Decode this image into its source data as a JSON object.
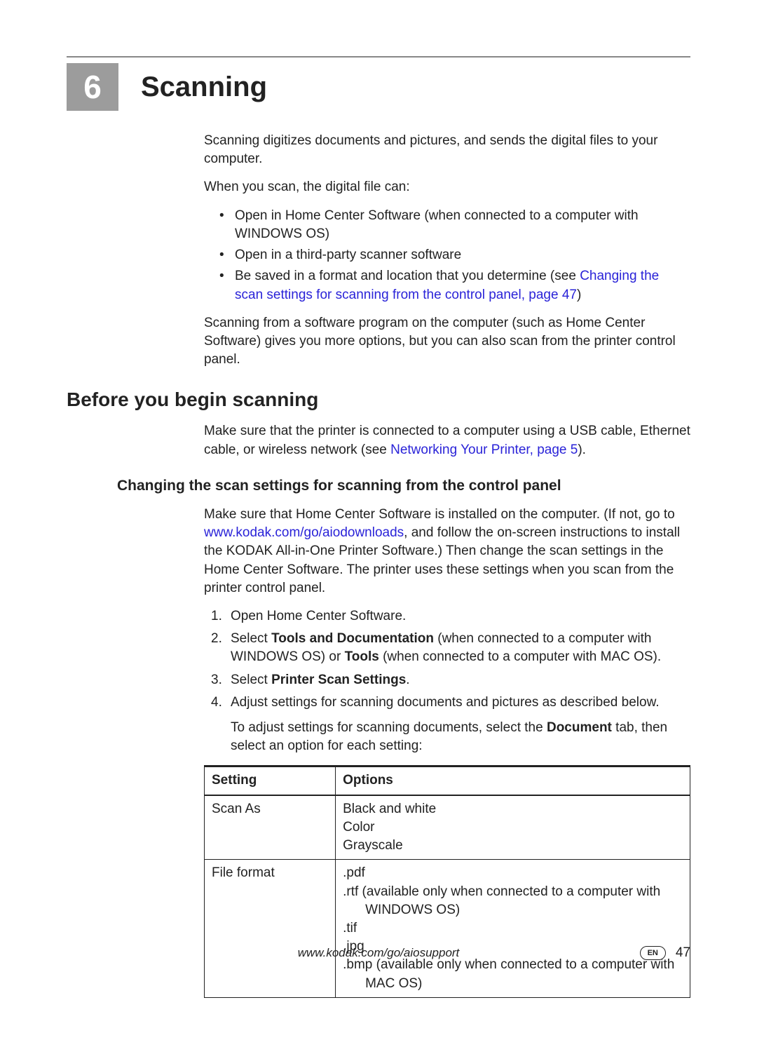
{
  "chapter": {
    "number": "6",
    "title": "Scanning"
  },
  "intro": {
    "p1": "Scanning digitizes documents and pictures, and sends the digital files to your computer.",
    "p2": "When you scan, the digital file can:",
    "bullets": {
      "b1": "Open in Home Center Software (when connected to a computer with WINDOWS OS)",
      "b2": "Open in a third-party scanner software",
      "b3_a": "Be saved in a format and location that you determine (see ",
      "b3_link": "Changing the scan settings for scanning from the control panel, page 47",
      "b3_b": ")"
    },
    "p3": "Scanning from a software program on the computer (such as Home Center Software) gives you more options, but you can also scan from the printer control panel."
  },
  "section2": {
    "heading": "Before you begin scanning",
    "p1_a": "Make sure that the printer is connected to a computer using a USB cable, Ethernet cable, or wireless network (see ",
    "p1_link": "Networking Your Printer, page 5",
    "p1_b": ")."
  },
  "section3": {
    "heading": "Changing the scan settings for scanning from the control panel",
    "p1_a": "Make sure that Home Center Software is installed on the computer. (If not, go to ",
    "p1_link": "www.kodak.com/go/aiodownloads",
    "p1_b": ", and follow the on-screen instructions to install the KODAK All-in-One Printer Software.) Then change the scan settings in the Home Center Software. The printer uses these settings when you scan from the printer control panel.",
    "steps": {
      "s1": "Open Home Center Software.",
      "s2_a": "Select ",
      "s2_b1": "Tools and Documentation",
      "s2_c": " (when connected to a computer with WINDOWS OS) or ",
      "s2_b2": "Tools",
      "s2_d": " (when connected to a computer with MAC OS).",
      "s3_a": "Select ",
      "s3_b": "Printer Scan Settings",
      "s3_c": ".",
      "s4": "Adjust settings for scanning documents and pictures as described below."
    },
    "p_after_a": "To adjust settings for scanning documents, select the ",
    "p_after_bold": "Document",
    "p_after_b": " tab, then select an option for each setting:"
  },
  "table": {
    "h1": "Setting",
    "h2": "Options",
    "r1_setting": "Scan As",
    "r1_o1": "Black and white",
    "r1_o2": "Color",
    "r1_o3": "Grayscale",
    "r2_setting": "File format",
    "r2_o1": ".pdf",
    "r2_o2a": ".rtf (available only when connected to a computer with",
    "r2_o2b": "WINDOWS OS)",
    "r2_o3": ".tif",
    "r2_o4": ".jpg",
    "r2_o5a": ".bmp (available only when connected to a computer with",
    "r2_o5b": "MAC OS)"
  },
  "footer": {
    "url": "www.kodak.com/go/aiosupport",
    "lang": "EN",
    "page": "47"
  }
}
